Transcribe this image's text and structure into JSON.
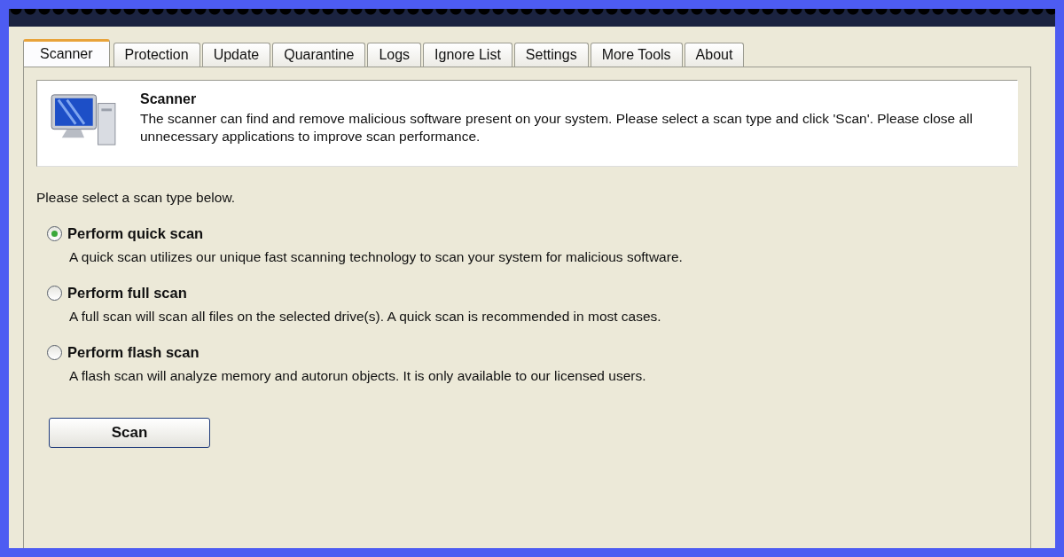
{
  "tabs": [
    {
      "label": "Scanner",
      "selected": true
    },
    {
      "label": "Protection",
      "selected": false
    },
    {
      "label": "Update",
      "selected": false
    },
    {
      "label": "Quarantine",
      "selected": false
    },
    {
      "label": "Logs",
      "selected": false
    },
    {
      "label": "Ignore List",
      "selected": false
    },
    {
      "label": "Settings",
      "selected": false
    },
    {
      "label": "More Tools",
      "selected": false
    },
    {
      "label": "About",
      "selected": false
    }
  ],
  "header": {
    "title": "Scanner",
    "description": "The scanner can find and remove malicious software present on your system. Please select a scan type and click 'Scan'. Please close all unnecessary applications to improve scan performance."
  },
  "prompt": "Please select a scan type below.",
  "scan_types": [
    {
      "label": "Perform quick scan",
      "description": "A quick scan utilizes our unique fast scanning technology to scan your system for malicious software.",
      "selected": true
    },
    {
      "label": "Perform full scan",
      "description": "A full scan will scan all files on the selected drive(s). A quick scan is recommended in most cases.",
      "selected": false
    },
    {
      "label": "Perform flash scan",
      "description": "A flash scan will analyze memory and autorun objects. It is only available to our licensed users.",
      "selected": false
    }
  ],
  "button": "Scan"
}
